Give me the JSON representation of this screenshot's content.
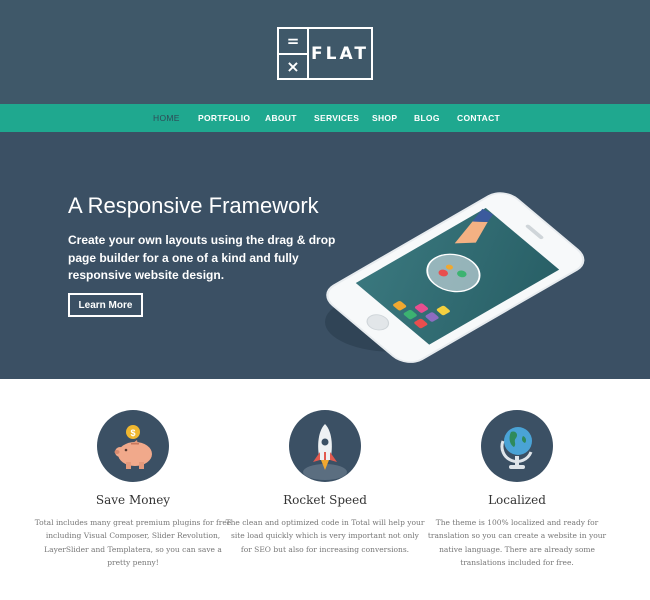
{
  "logo": {
    "top_symbol": "=",
    "bottom_symbol": "×",
    "text": "FLAT"
  },
  "nav": {
    "items": [
      {
        "label": "HOME",
        "active": true
      },
      {
        "label": "PORTFOLIO"
      },
      {
        "label": "ABOUT"
      },
      {
        "label": "SERVICES"
      },
      {
        "label": "SHOP"
      },
      {
        "label": "BLOG"
      },
      {
        "label": "CONTACT"
      }
    ]
  },
  "hero": {
    "title": "A Responsive Framework",
    "subtitle": "Create your own layouts using the drag & drop page builder for a one of a kind and fully responsive website design.",
    "button_label": "Learn More"
  },
  "features": [
    {
      "icon": "piggy-bank-icon",
      "title": "Save Money",
      "description": "Total includes many great premium plugins for free including Visual Composer, Slider Revolution, LayerSlider and Templatera, so you can save a pretty penny!"
    },
    {
      "icon": "rocket-icon",
      "title": "Rocket Speed",
      "description": "The clean and optimized code in Total will help your site load quickly which is very important not only for SEO but also for increasing conversions."
    },
    {
      "icon": "globe-icon",
      "title": "Localized",
      "description": "The theme is 100% localized and ready for translation so you can create a website in your native language. There are already some translations included for free."
    }
  ],
  "colors": {
    "header_bg": "#3f5869",
    "nav_bg": "#1fa88f",
    "hero_bg": "#3b5064",
    "feature_circle": "#3b5064"
  }
}
